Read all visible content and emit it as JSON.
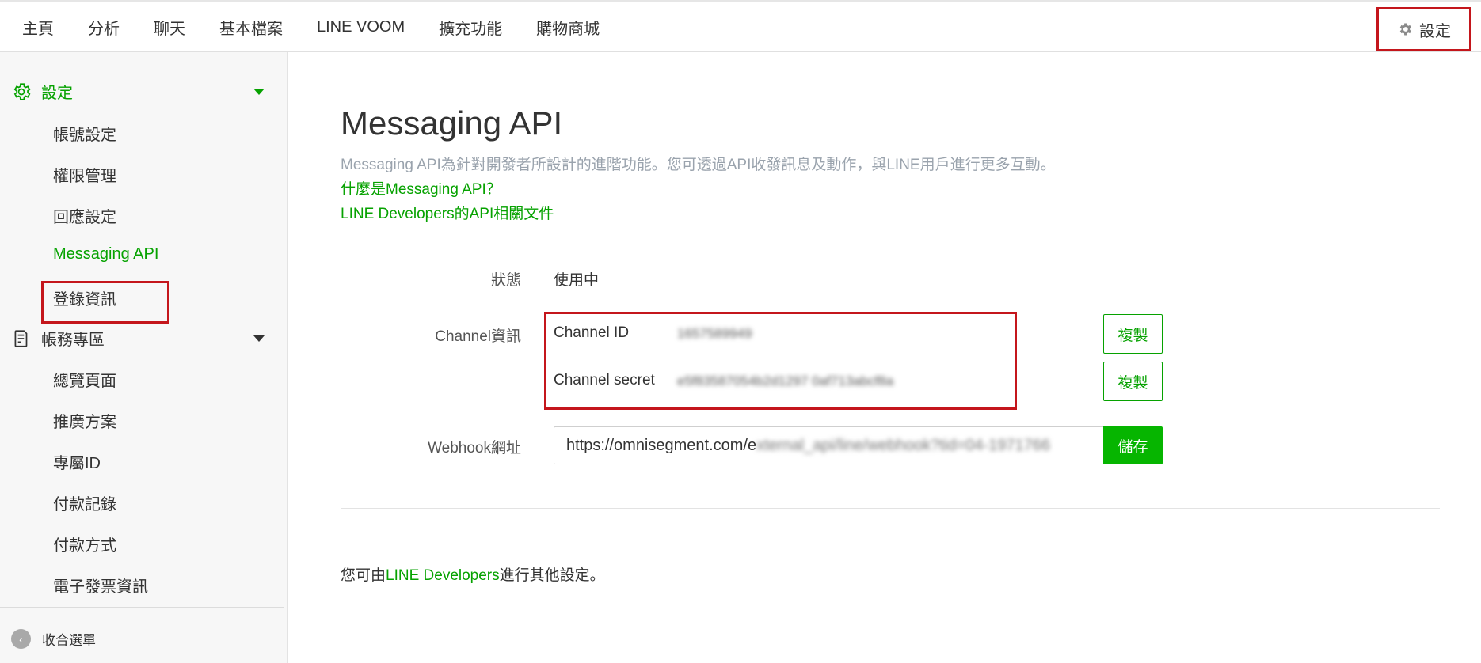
{
  "topnav": {
    "items": [
      "主頁",
      "分析",
      "聊天",
      "基本檔案",
      "LINE VOOM",
      "擴充功能",
      "購物商城"
    ],
    "settings_label": "設定"
  },
  "sidebar": {
    "settings_section": "設定",
    "settings_items": [
      "帳號設定",
      "權限管理",
      "回應設定",
      "Messaging API",
      "登錄資訊"
    ],
    "billing_section": "帳務專區",
    "billing_items": [
      "總覽頁面",
      "推廣方案",
      "專屬ID",
      "付款記錄",
      "付款方式",
      "電子發票資訊"
    ],
    "collapse_label": "收合選單"
  },
  "main": {
    "title": "Messaging API",
    "description": "Messaging API為針對開發者所設計的進階功能。您可透過API收發訊息及動作，與LINE用戶進行更多互動。",
    "link_what": "什麼是Messaging API？",
    "link_docs": "LINE Developers的API相關文件",
    "status_label": "狀態",
    "status_value": "使用中",
    "channel_label": "Channel資訊",
    "channel_id_label": "Channel ID",
    "channel_id_value": "1657589949",
    "channel_secret_label": "Channel secret",
    "channel_secret_value": "e5f83587054b2d1297 0af713abcf8a",
    "copy_label": "複製",
    "webhook_label": "Webhook網址",
    "webhook_value_visible": "https://omnisegment.com/e",
    "webhook_value_blurred": "xternal_api/line/webhook?tid=04-1971766",
    "save_label": "儲存",
    "footer_prefix": "您可由",
    "footer_link": "LINE Developers",
    "footer_suffix": "進行其他設定。"
  },
  "colors": {
    "accent": "#06a200",
    "highlight_box": "#c4161c"
  }
}
